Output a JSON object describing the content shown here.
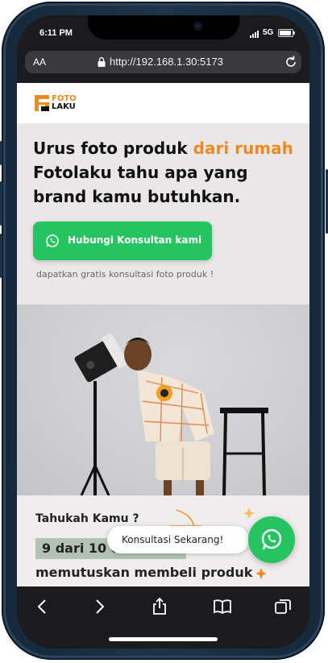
{
  "status_bar": {
    "time": "6:11 PM",
    "network": "5G"
  },
  "browser": {
    "text_size_label": "AA",
    "url": "http://192.168.1.30:5173"
  },
  "header": {
    "logo_line1": "FOTO",
    "logo_line2": "LAKU",
    "brand_color": "#f08a1d"
  },
  "hero": {
    "headline_part1": "Urus foto produk ",
    "headline_accent": "dari rumah",
    "headline_line2": "Fotolaku tahu apa yang",
    "headline_line3": "brand kamu butuhkan.",
    "cta_label": "Hubungi Konsultan kami",
    "cta_color": "#25c461",
    "note": "dapatkan gratis konsultasi foto produk !"
  },
  "info": {
    "question": "Tahukah Kamu ?",
    "stat": "9 dari 10 customer",
    "line": "memutuskan membeli produk"
  },
  "floating": {
    "label": "Konsultasi Sekarang!"
  },
  "toolbar": {
    "icons": [
      "back-icon",
      "forward-icon",
      "share-icon",
      "bookmarks-icon",
      "tabs-icon"
    ]
  }
}
